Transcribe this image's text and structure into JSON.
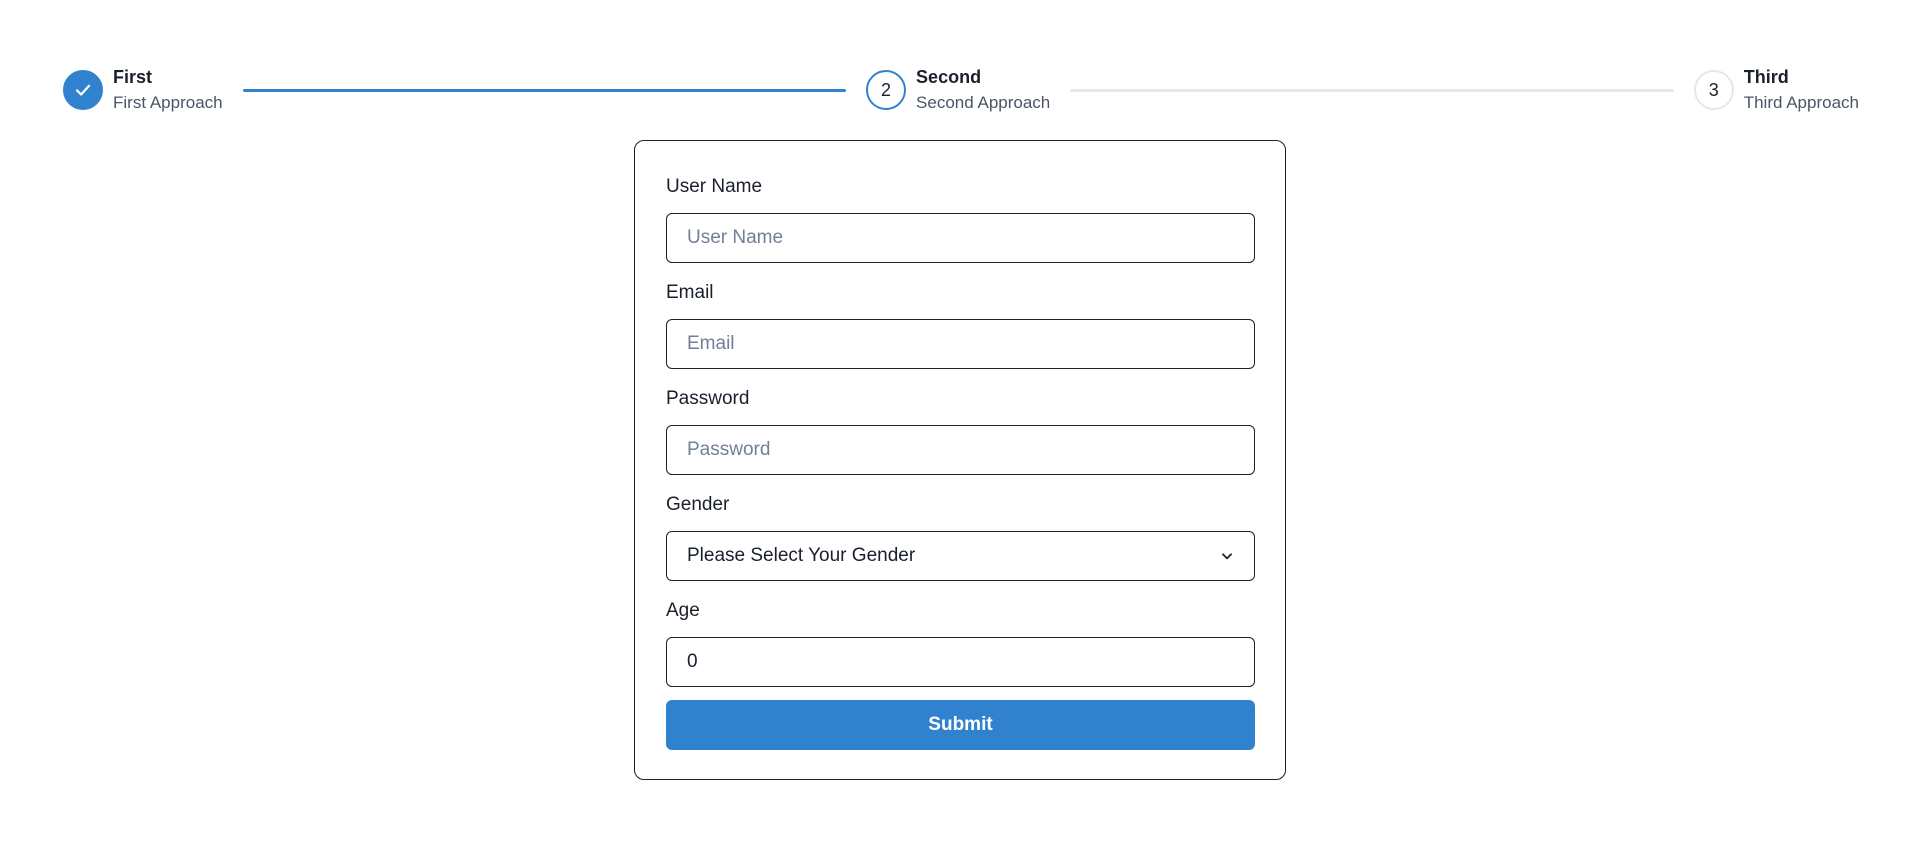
{
  "stepper": {
    "steps": [
      {
        "title": "First",
        "description": "First Approach",
        "number": "1",
        "status": "complete"
      },
      {
        "title": "Second",
        "description": "Second Approach",
        "number": "2",
        "status": "active"
      },
      {
        "title": "Third",
        "description": "Third Approach",
        "number": "3",
        "status": "incomplete"
      }
    ],
    "accent_color": "#3182ce",
    "inactive_color": "#e2e8f0"
  },
  "form": {
    "username": {
      "label": "User Name",
      "placeholder": "User Name",
      "value": ""
    },
    "email": {
      "label": "Email",
      "placeholder": "Email",
      "value": ""
    },
    "password": {
      "label": "Password",
      "placeholder": "Password",
      "value": ""
    },
    "gender": {
      "label": "Gender",
      "selected": "Please Select Your Gender",
      "icon": "chevron-down-icon"
    },
    "age": {
      "label": "Age",
      "value": "0"
    },
    "submit_label": "Submit"
  }
}
